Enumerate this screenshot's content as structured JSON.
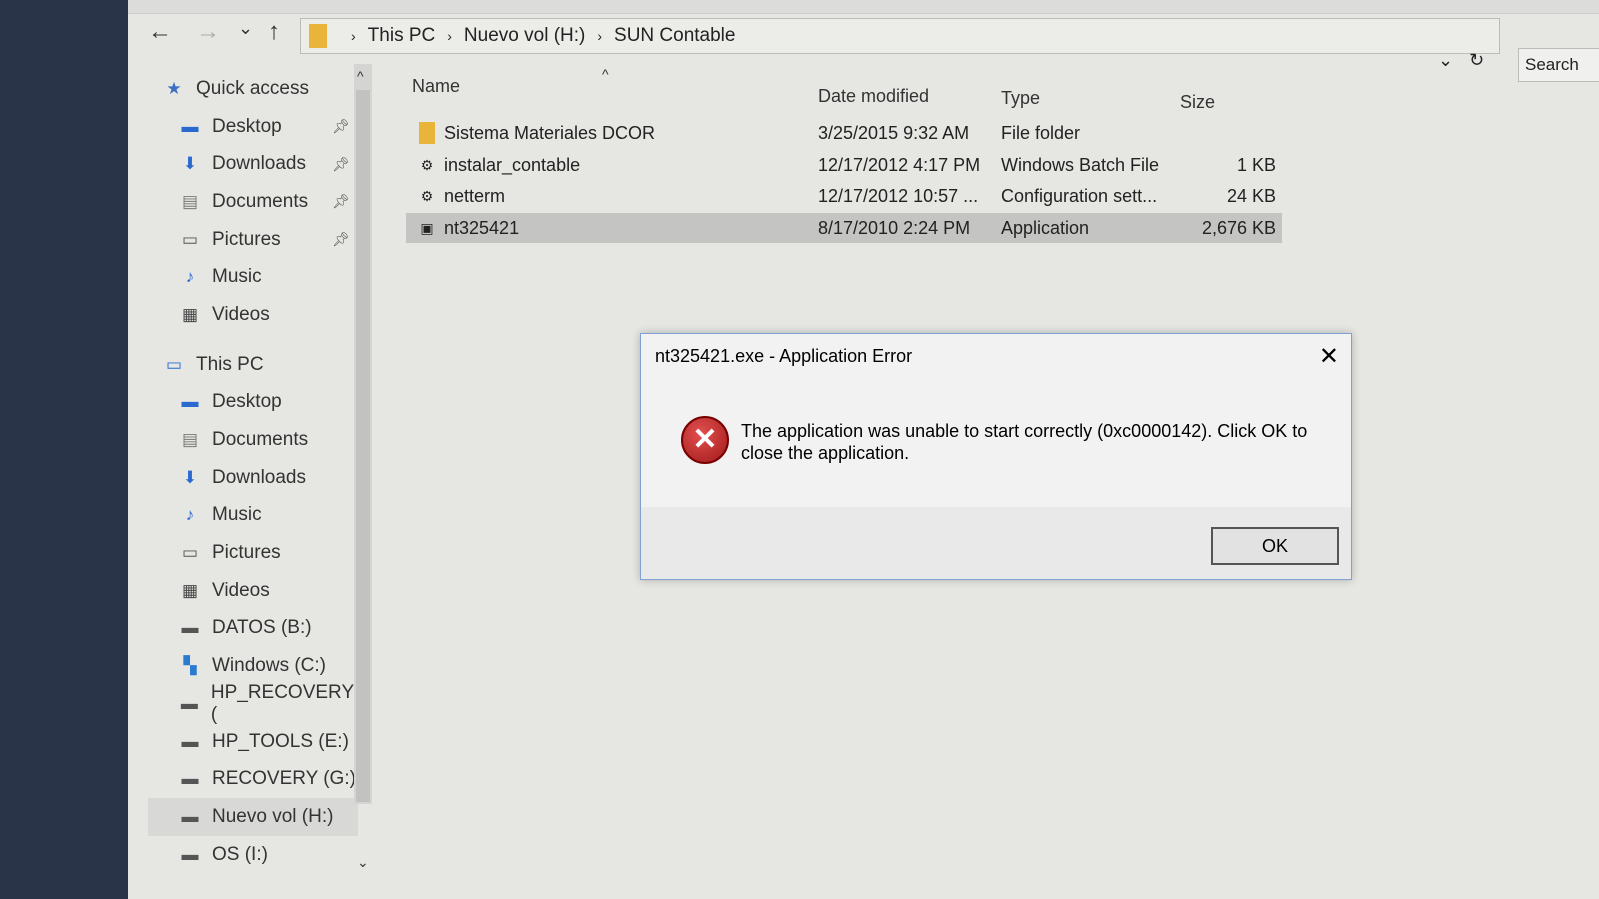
{
  "nav": {
    "back": "←",
    "forward": "→",
    "recent": "⌄",
    "up": "↑"
  },
  "breadcrumb": [
    "This PC",
    "Nuevo vol (H:)",
    "SUN Contable"
  ],
  "search": {
    "placeholder": "Search"
  },
  "sidebar": {
    "items": [
      {
        "label": "Quick access",
        "icon": "star-icon",
        "pinned": false,
        "indent": 0
      },
      {
        "label": "Desktop",
        "icon": "desktop-icon",
        "pinned": true,
        "indent": 1
      },
      {
        "label": "Downloads",
        "icon": "download-icon",
        "pinned": true,
        "indent": 1
      },
      {
        "label": "Documents",
        "icon": "documents-icon",
        "pinned": true,
        "indent": 1
      },
      {
        "label": "Pictures",
        "icon": "pictures-icon",
        "pinned": true,
        "indent": 1
      },
      {
        "label": "Music",
        "icon": "music-icon",
        "pinned": false,
        "indent": 1
      },
      {
        "label": "Videos",
        "icon": "videos-icon",
        "pinned": false,
        "indent": 1
      },
      {
        "label": "This PC",
        "icon": "computer-icon",
        "pinned": false,
        "indent": 0
      },
      {
        "label": "Desktop",
        "icon": "desktop-icon",
        "pinned": false,
        "indent": 1
      },
      {
        "label": "Documents",
        "icon": "documents-icon",
        "pinned": false,
        "indent": 1
      },
      {
        "label": "Downloads",
        "icon": "download-icon",
        "pinned": false,
        "indent": 1
      },
      {
        "label": "Music",
        "icon": "music-icon",
        "pinned": false,
        "indent": 1
      },
      {
        "label": "Pictures",
        "icon": "pictures-icon",
        "pinned": false,
        "indent": 1
      },
      {
        "label": "Videos",
        "icon": "videos-icon",
        "pinned": false,
        "indent": 1
      },
      {
        "label": "DATOS (B:)",
        "icon": "drive-icon",
        "pinned": false,
        "indent": 1
      },
      {
        "label": "Windows (C:)",
        "icon": "windows-drive-icon",
        "pinned": false,
        "indent": 1
      },
      {
        "label": "HP_RECOVERY (",
        "icon": "drive-icon",
        "pinned": false,
        "indent": 1
      },
      {
        "label": "HP_TOOLS (E:)",
        "icon": "drive-icon",
        "pinned": false,
        "indent": 1
      },
      {
        "label": "RECOVERY (G:)",
        "icon": "drive-icon",
        "pinned": false,
        "indent": 1
      },
      {
        "label": "Nuevo vol (H:)",
        "icon": "drive-icon",
        "pinned": false,
        "indent": 1,
        "selected": true
      },
      {
        "label": "OS (I:)",
        "icon": "drive-icon",
        "pinned": false,
        "indent": 1
      }
    ]
  },
  "columns": {
    "name": "Name",
    "date": "Date modified",
    "type": "Type",
    "size": "Size"
  },
  "files": [
    {
      "name": "Sistema Materiales DCOR",
      "date": "3/25/2015 9:32 AM",
      "type": "File folder",
      "size": "",
      "icon": "folder-icon"
    },
    {
      "name": "instalar_contable",
      "date": "12/17/2012 4:17 PM",
      "type": "Windows Batch File",
      "size": "1 KB",
      "icon": "batch-file-icon"
    },
    {
      "name": "netterm",
      "date": "12/17/2012 10:57 ...",
      "type": "Configuration sett...",
      "size": "24 KB",
      "icon": "config-file-icon"
    },
    {
      "name": "nt325421",
      "date": "8/17/2010 2:24 PM",
      "type": "Application",
      "size": "2,676 KB",
      "icon": "application-icon",
      "selected": true
    }
  ],
  "dialog": {
    "title": "nt325421.exe - Application Error",
    "message": "The application was unable to start correctly (0xc0000142). Click OK to close the application.",
    "ok": "OK",
    "close": "✕"
  }
}
